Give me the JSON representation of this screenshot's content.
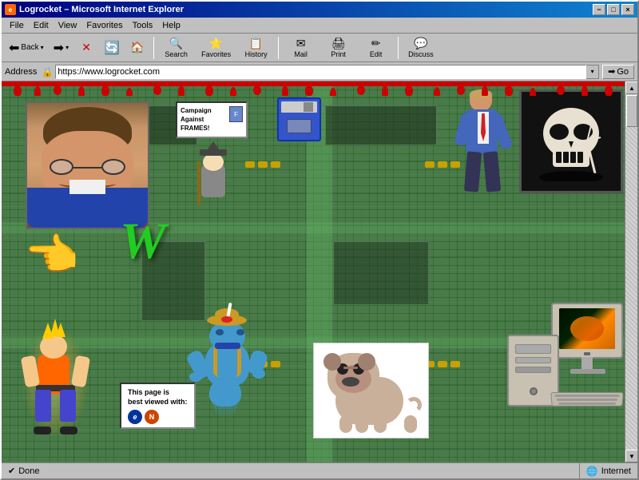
{
  "window": {
    "title": "Logrocket – Microsoft Internet Explorer",
    "titlebar_icon": "🌐",
    "minimize_label": "−",
    "maximize_label": "□",
    "close_label": "×"
  },
  "menu": {
    "items": [
      {
        "label": "File",
        "id": "file"
      },
      {
        "label": "Edit",
        "id": "edit"
      },
      {
        "label": "View",
        "id": "view"
      },
      {
        "label": "Favorites",
        "id": "favorites"
      },
      {
        "label": "Tools",
        "id": "tools"
      },
      {
        "label": "Help",
        "id": "help"
      }
    ]
  },
  "toolbar": {
    "back_label": "Back",
    "forward_label": "Forward",
    "stop_label": "Stop",
    "refresh_label": "Refresh",
    "home_label": "Home",
    "search_label": "Search",
    "favorites_label": "Favorites",
    "history_label": "History",
    "mail_label": "Mail",
    "print_label": "Print",
    "edit_label": "Edit",
    "discuss_label": "Discuss"
  },
  "address_bar": {
    "label": "Address",
    "url": "https://www.logrocket.com",
    "go_label": "Go"
  },
  "content": {
    "campaign_title": "Campaign Against",
    "campaign_subtitle": "FRAMES!",
    "viewed_with_line1": "This page is",
    "viewed_with_line2": "best viewed with:",
    "green_w": "W",
    "skull_emoji": "💀",
    "pointing_hand": "👉"
  },
  "status_bar": {
    "status_text": "Done",
    "zone_text": "Internet",
    "zone_icon": "🌐"
  },
  "colors": {
    "title_bar_start": "#000080",
    "title_bar_end": "#1084d0",
    "pcb_bg": "#4a7a4a",
    "skull_bg": "#000000",
    "green_w": "#22cc22",
    "drip_red": "#cc0000"
  }
}
